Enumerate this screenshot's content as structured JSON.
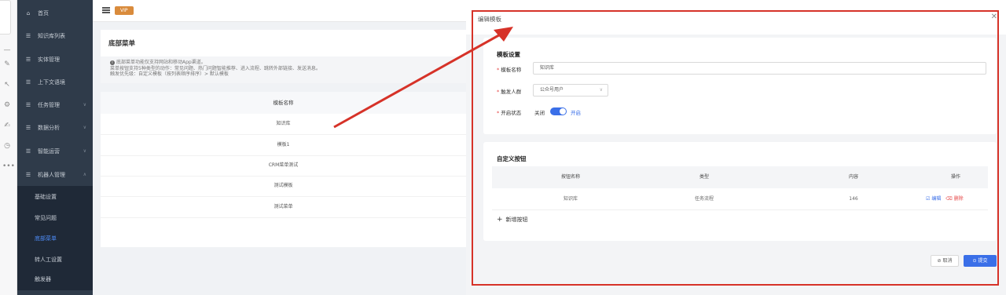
{
  "sidebar": {
    "items": [
      {
        "label": "首页",
        "icon": "home-icon",
        "has_arrow": false
      },
      {
        "label": "知识库列表",
        "icon": "list-icon",
        "has_arrow": false
      },
      {
        "label": "实体管理",
        "icon": "list-icon",
        "has_arrow": false
      },
      {
        "label": "上下文语境",
        "icon": "list-icon",
        "has_arrow": false
      },
      {
        "label": "任务管理",
        "icon": "list-icon",
        "has_arrow": true
      },
      {
        "label": "数据分析",
        "icon": "list-icon",
        "has_arrow": true
      },
      {
        "label": "智能运营",
        "icon": "list-icon",
        "has_arrow": true
      },
      {
        "label": "机器人管理",
        "icon": "list-icon",
        "has_arrow": true
      }
    ],
    "sub_items": [
      "基础设置",
      "常见问题",
      "底部菜单",
      "转人工设置",
      "触发器"
    ],
    "active_sub": "底部菜单"
  },
  "topbar": {
    "vip_label": "VIP"
  },
  "notice": {
    "title": "底部菜单",
    "lines": [
      "底部菜单功能仅支持网站和移动App渠道。",
      "菜单按钮支持5种类型的动作：常见问题、热门问题智能推荐、进入流程、跳转外部链接、发送消息。",
      "触发优先级：自定义模板（按列表顺序排序）> 默认模板"
    ]
  },
  "template_table": {
    "header": "模板名称",
    "rows": [
      "知识库",
      "模板1",
      "CRM菜单测试",
      "测试模板",
      "测试菜单"
    ]
  },
  "drawer": {
    "title": "编辑模板",
    "settings_title": "模板设置",
    "name_label": "模板名称",
    "name_value": "知识库",
    "audience_label": "触发人群",
    "audience_value": "公众号用户",
    "status_label": "开启状态",
    "status_off": "关闭",
    "status_on": "开启",
    "status_enabled": true,
    "buttons_title": "自定义按钮",
    "columns": [
      "按钮名称",
      "类型",
      "内容",
      "操作"
    ],
    "rows": [
      {
        "name": "知识库",
        "type": "任务流程",
        "content": "146",
        "edit": "编辑",
        "delete": "删除"
      }
    ],
    "add_button": "新增按钮",
    "cancel": "取消",
    "submit": "提交"
  },
  "colors": {
    "accent": "#3a6fe8",
    "sidebar": "#2f3b4a",
    "highlight_frame": "#d63228",
    "vip": "#d98b3c"
  }
}
